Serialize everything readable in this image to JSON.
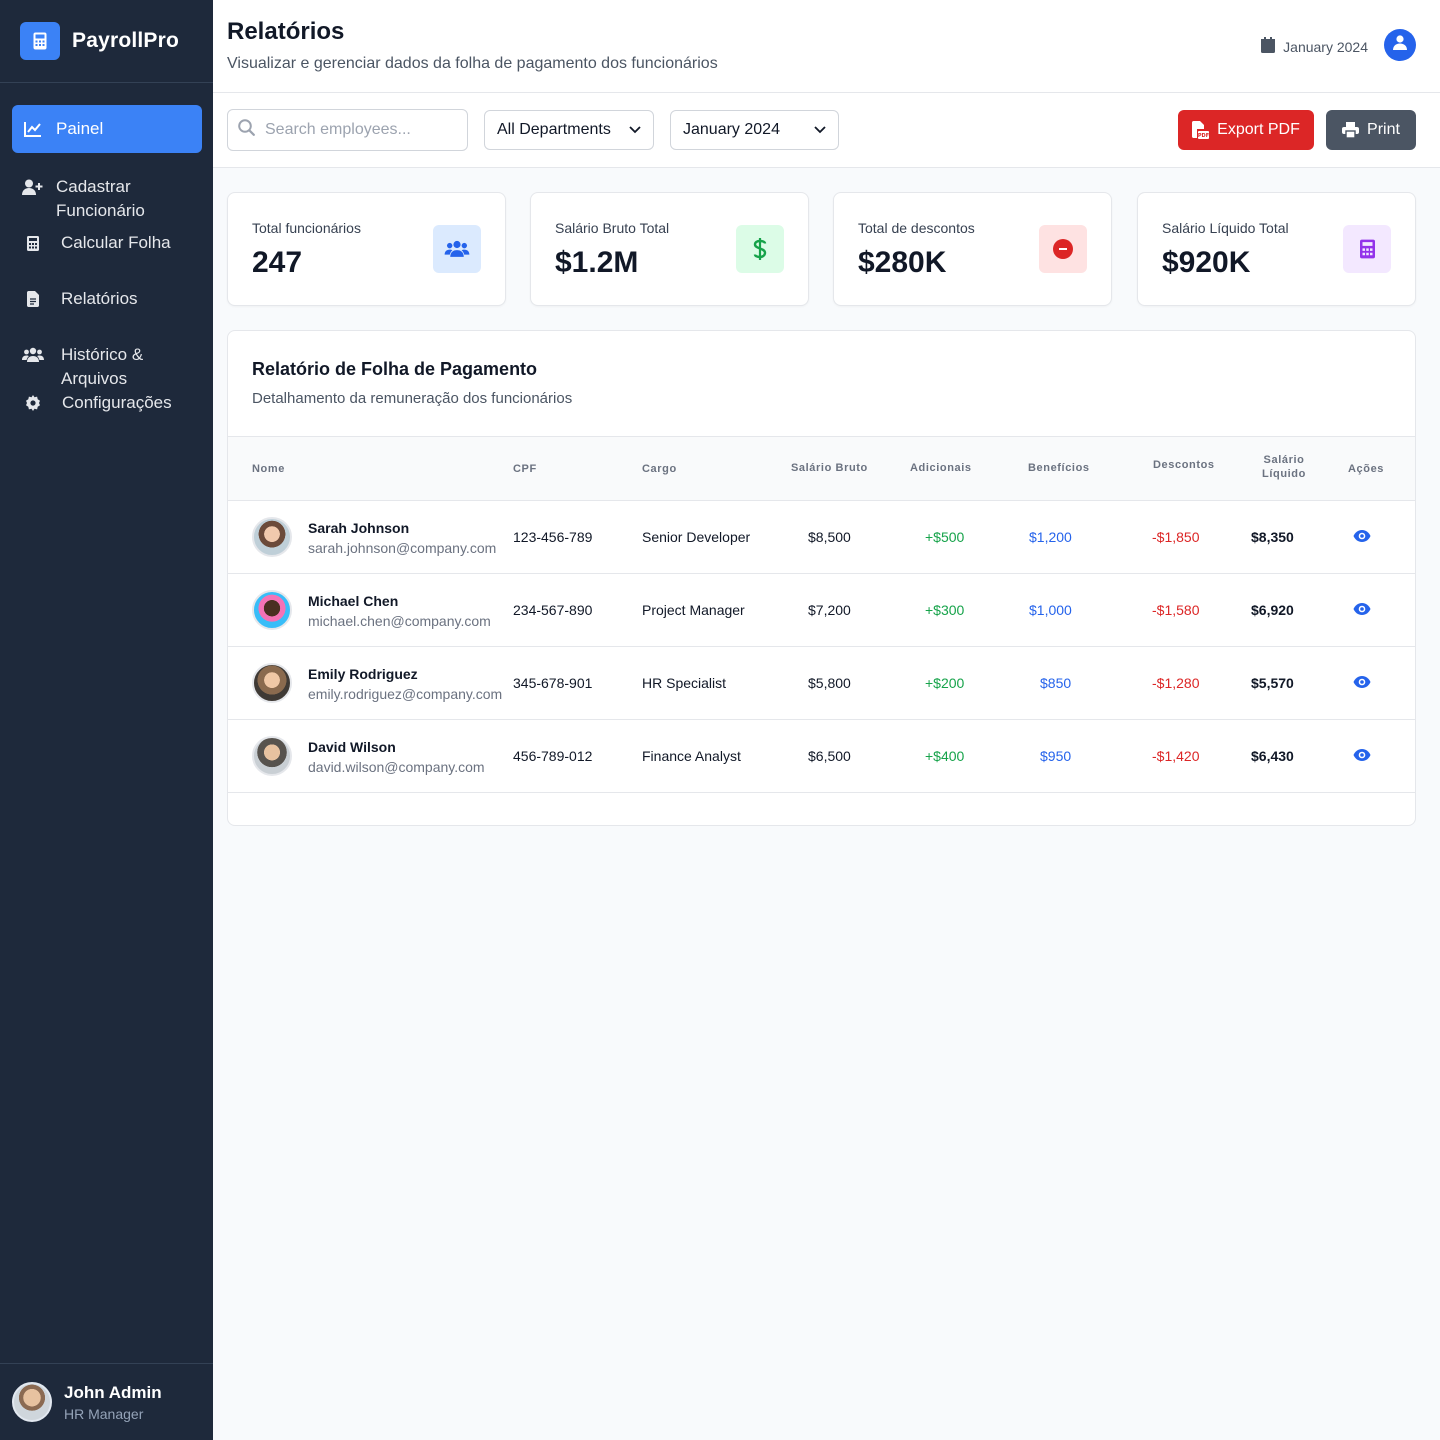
{
  "brand": {
    "name": "PayrollPro",
    "logo_icon": "calculator-icon"
  },
  "sidebar": {
    "items": [
      {
        "label": "Painel",
        "icon": "chart-line-icon",
        "active": true
      },
      {
        "label": "Cadastrar Funcionário",
        "icon": "user-plus-icon",
        "active": false
      },
      {
        "label": "Calcular Folha",
        "icon": "calculator-icon",
        "active": false
      },
      {
        "label": "Relatórios",
        "icon": "file-alt-icon",
        "active": false
      },
      {
        "label": "Histórico & Arquivos",
        "icon": "users-icon",
        "active": false
      },
      {
        "label": "Configurações",
        "icon": "gear-icon",
        "active": false
      }
    ],
    "user": {
      "name": "John Admin",
      "role": "HR Manager"
    }
  },
  "header": {
    "title": "Relatórios",
    "subtitle": "Visualizar e gerenciar dados da folha de pagamento dos funcionários",
    "date": "January 2024"
  },
  "toolbar": {
    "search_placeholder": "Search employees...",
    "department_select": "All Departments",
    "period_select": "January 2024",
    "export_label": "Export PDF",
    "print_label": "Print"
  },
  "stats": [
    {
      "label": "Total funcionários",
      "value": "247",
      "icon": "users-icon",
      "color": "#2563eb",
      "bg": "#dbeafe"
    },
    {
      "label": "Salário Bruto Total",
      "value": "$1.2M",
      "icon": "dollar-icon",
      "color": "#16a34a",
      "bg": "#dcfce7"
    },
    {
      "label": "Total de descontos",
      "value": "$280K",
      "icon": "minus-circle-icon",
      "color": "#dc2626",
      "bg": "#fee2e2"
    },
    {
      "label": "Salário Líquido Total",
      "value": "$920K",
      "icon": "calculator-icon",
      "color": "#9333ea",
      "bg": "#f3e8ff"
    }
  ],
  "report": {
    "title": "Relatório de Folha de Pagamento",
    "subtitle": "Detalhamento da remuneração dos funcionários",
    "columns": {
      "name": "Nome",
      "cpf": "CPF",
      "role": "Cargo",
      "gross": "Salário Bruto",
      "additions": "Adicionais",
      "benefits": "Benefícios",
      "deductions": "Descontos",
      "net_line1": "Salário",
      "net_line2": "Líquido",
      "actions": "Ações"
    },
    "rows": [
      {
        "name": "Sarah Johnson",
        "email": "sarah.johnson@company.com",
        "cpf": "123-456-789",
        "role": "Senior Developer",
        "gross": "$8,500",
        "additions": "+$500",
        "benefits": "$1,200",
        "deductions": "-$1,850",
        "net": "$8,350"
      },
      {
        "name": "Michael Chen",
        "email": "michael.chen@company.com",
        "cpf": "234-567-890",
        "role": "Project Manager",
        "gross": "$7,200",
        "additions": "+$300",
        "benefits": "$1,000",
        "deductions": "-$1,580",
        "net": "$6,920"
      },
      {
        "name": "Emily Rodriguez",
        "email": "emily.rodriguez@company.com",
        "cpf": "345-678-901",
        "role": "HR Specialist",
        "gross": "$5,800",
        "additions": "+$200",
        "benefits": "$850",
        "deductions": "-$1,280",
        "net": "$5,570"
      },
      {
        "name": "David Wilson",
        "email": "david.wilson@company.com",
        "cpf": "456-789-012",
        "role": "Finance Analyst",
        "gross": "$6,500",
        "additions": "+$400",
        "benefits": "$950",
        "deductions": "-$1,420",
        "net": "$6,430"
      }
    ]
  },
  "colors": {
    "sidebar_bg": "#1e293b",
    "accent": "#3b82f6",
    "export_btn": "#dc2626",
    "print_btn": "#4b5563"
  }
}
